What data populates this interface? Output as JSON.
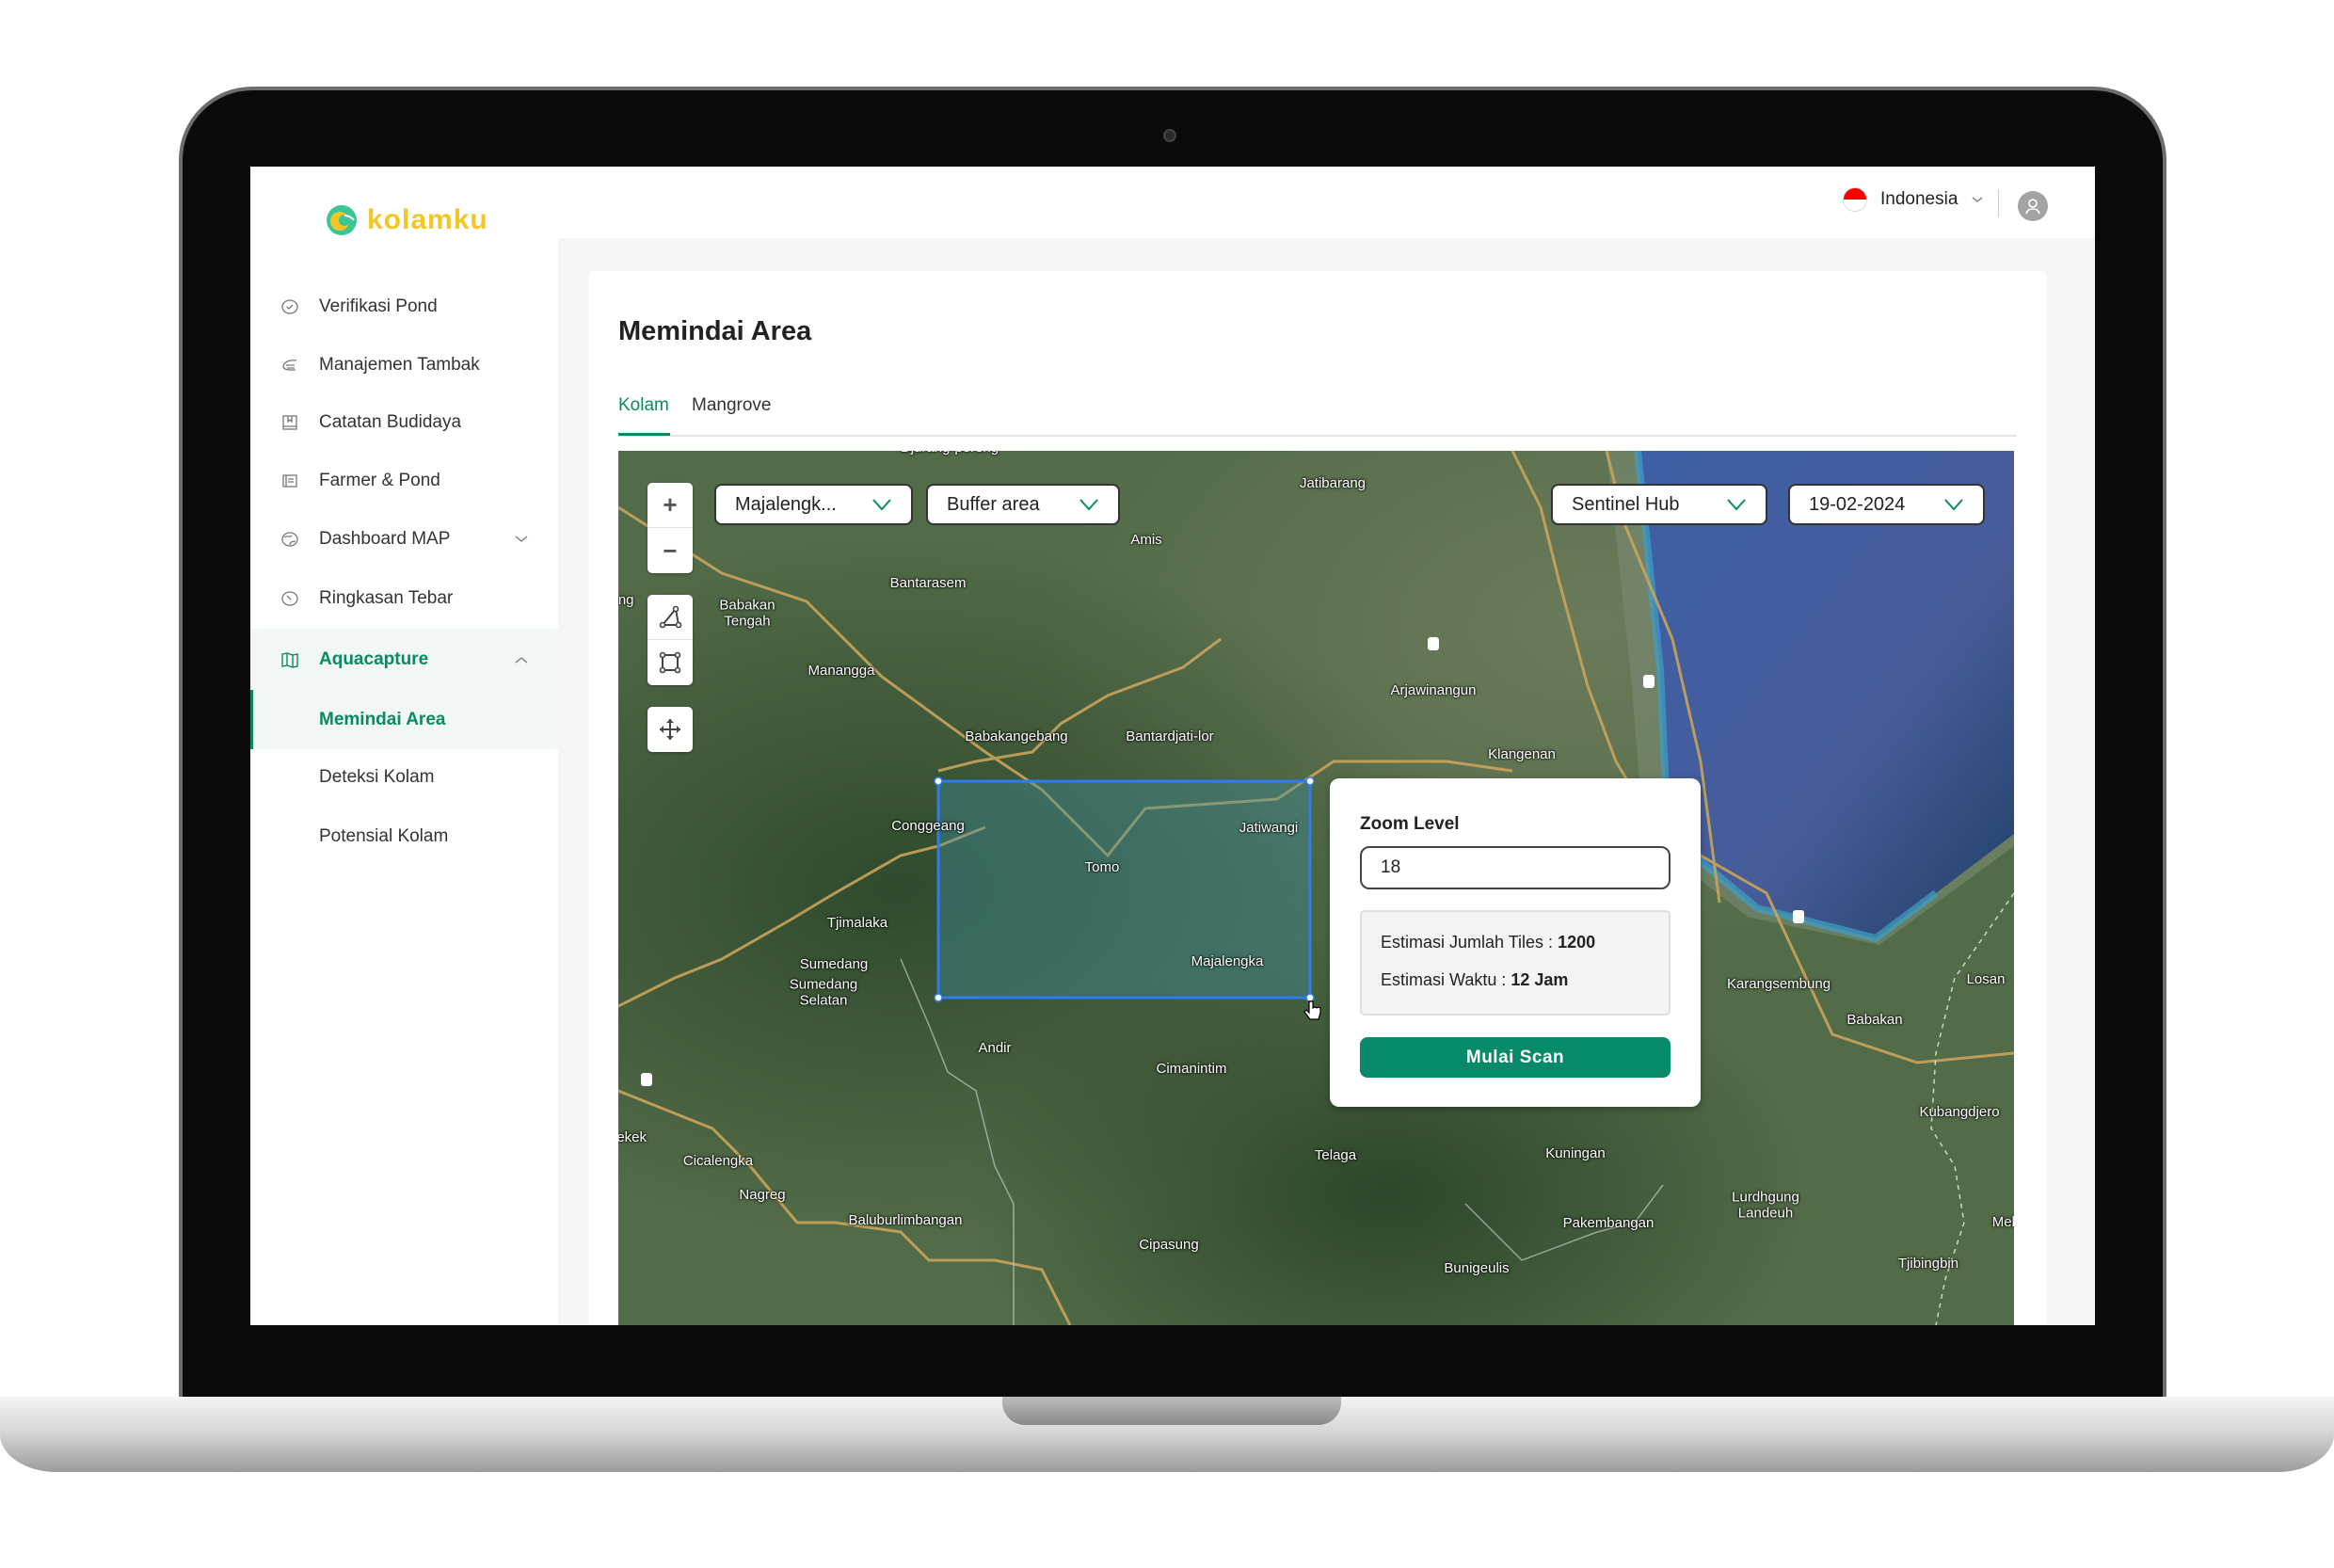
{
  "app": {
    "brand": "kolamku",
    "accent": "#0a8a63",
    "brand_yellow": "#f3c623"
  },
  "header": {
    "language": "Indonesia",
    "flag_icon": "indonesia-flag",
    "avatar_icon": "user-icon"
  },
  "sidebar": {
    "items": [
      {
        "label": "Verifikasi Pond",
        "icon": "check-circle-icon"
      },
      {
        "label": "Manajemen Tambak",
        "icon": "shrimp-icon"
      },
      {
        "label": "Catatan Budidaya",
        "icon": "book-icon"
      },
      {
        "label": "Farmer &  Pond",
        "icon": "list-icon"
      },
      {
        "label": "Dashboard MAP",
        "icon": "globe-icon",
        "expandable": true
      },
      {
        "label": "Ringkasan Tebar",
        "icon": "gauge-icon"
      },
      {
        "label": "Aquacapture",
        "icon": "map-icon",
        "expanded": true,
        "active": true
      }
    ],
    "subitems": [
      {
        "label": "Memindai Area",
        "active": true
      },
      {
        "label": "Deteksi Kolam"
      },
      {
        "label": "Potensial Kolam"
      }
    ]
  },
  "main": {
    "title": "Memindai Area",
    "tabs": [
      {
        "label": "Kolam",
        "active": true
      },
      {
        "label": "Mangrove"
      }
    ]
  },
  "map": {
    "filters": {
      "region": "Majalengk...",
      "layer": "Buffer area",
      "source": "Sentinel Hub",
      "date": "19-02-2024"
    },
    "labels": [
      "Djurang-pereng",
      "Jatibarang",
      "Amis",
      "Bantarasem",
      "Babakan\nTengah",
      "Manangga",
      "Babakangebang",
      "Bantardjati-lor",
      "Arjawinangun",
      "Klangenan",
      "Conggeang",
      "Jatiwangi",
      "Tomo",
      "Majalengka",
      "Tjimalaka",
      "Sumedang",
      "Sumedang\nSelatan",
      "Andir",
      "Cimanintim",
      "aekek",
      "Cicalengka",
      "Nagreg",
      "Baluburlimbangan",
      "Cipasung",
      "Telaga",
      "Kuningan",
      "Pakembangan",
      "Bunigeulis",
      "Lurdhgung\nLandeuh",
      "Tjibingbin",
      "Kubangdjero",
      "Mela",
      "Karangsembung",
      "Babakan",
      "Losan",
      "ang"
    ],
    "road_shields": [
      "1",
      "7",
      "5"
    ]
  },
  "popup": {
    "zoom_label": "Zoom Level",
    "zoom_value": "18",
    "tiles_label": "Estimasi Jumlah Tiles : ",
    "tiles_value": "1200",
    "time_label": "Estimasi Waktu : ",
    "time_value": "12 Jam",
    "button": "Mulai Scan"
  }
}
